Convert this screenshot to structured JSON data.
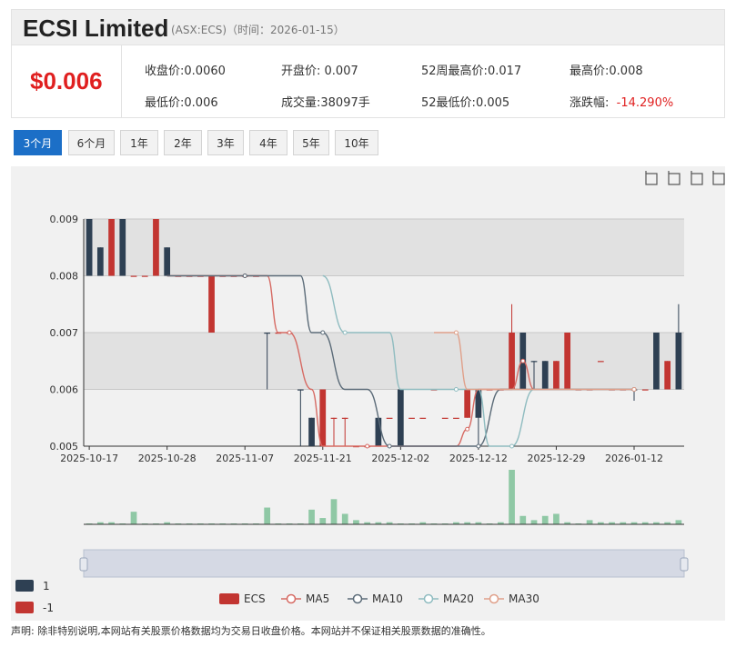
{
  "header": {
    "company": "ECSI Limited",
    "ticker_info": "(ASX:ECS)（时间：2026-01-15）"
  },
  "quote": {
    "price": "$0.006",
    "stats": [
      {
        "label": "收盘价:",
        "value": "0.0060"
      },
      {
        "label": "开盘价:",
        "value": " 0.007"
      },
      {
        "label": "52周最高价:",
        "value": "0.017"
      },
      {
        "label": "最高价:",
        "value": "0.008"
      },
      {
        "label": "最低价:",
        "value": "0.006"
      },
      {
        "label": "成交量:",
        "value": "38097手"
      },
      {
        "label": "52最低价:",
        "value": "0.005"
      },
      {
        "label": "涨跌幅:",
        "value": "-14.290%"
      }
    ]
  },
  "tabs": [
    "3个月",
    "6个月",
    "1年",
    "2年",
    "3年",
    "4年",
    "5年",
    "10年"
  ],
  "active_tab": 0,
  "toolbar": [
    "zoom-icon",
    "zoom-reset-icon",
    "restore-icon",
    "save-icon"
  ],
  "colors": {
    "up": "#2e4053",
    "down": "#c23531",
    "ma5": "#d66a63",
    "ma10": "#5b6b78",
    "ma20": "#8fbcc0",
    "ma30": "#e0a08a",
    "volume": "#8fc8a5",
    "accent": "#1c6fc7",
    "negative": "#e02020"
  },
  "chart_data": {
    "type": "candlestick",
    "ylim": [
      0.005,
      0.009
    ],
    "y_ticks": [
      "0.009",
      "0.008",
      "0.007",
      "0.006",
      "0.005"
    ],
    "x_ticks": [
      {
        "label": "2025-10-17",
        "i": 0
      },
      {
        "label": "2025-10-28",
        "i": 7
      },
      {
        "label": "2025-11-07",
        "i": 14
      },
      {
        "label": "2025-11-21",
        "i": 21
      },
      {
        "label": "2025-12-02",
        "i": 28
      },
      {
        "label": "2025-12-12",
        "i": 35
      },
      {
        "label": "2025-12-29",
        "i": 42
      },
      {
        "label": "2026-01-12",
        "i": 49
      }
    ],
    "candles": [
      [
        0.008,
        0.009,
        0.008,
        0.009,
        1,
        0
      ],
      [
        0.008,
        0.0085,
        0.008,
        0.0085,
        1,
        1
      ],
      [
        0.009,
        0.009,
        0.008,
        0.008,
        -1,
        1
      ],
      [
        0.008,
        0.009,
        0.008,
        0.009,
        1,
        0
      ],
      [
        0.008,
        0.008,
        0.008,
        0.008,
        -1,
        6
      ],
      [
        0.008,
        0.008,
        0.008,
        0.008,
        -1,
        0
      ],
      [
        0.009,
        0.009,
        0.008,
        0.008,
        -1,
        0
      ],
      [
        0.008,
        0.0085,
        0.008,
        0.0085,
        1,
        1
      ],
      [
        0.008,
        0.008,
        0.008,
        0.008,
        -1,
        0
      ],
      [
        0.008,
        0.008,
        0.008,
        0.008,
        -1,
        0
      ],
      [
        0.008,
        0.008,
        0.008,
        0.008,
        -1,
        0
      ],
      [
        0.008,
        0.008,
        0.007,
        0.007,
        -1,
        0
      ],
      [
        0.008,
        0.008,
        0.008,
        0.008,
        -1,
        0
      ],
      [
        0.008,
        0.008,
        0.008,
        0.008,
        -1,
        0
      ],
      [
        0.008,
        0.008,
        0.008,
        0.008,
        -1,
        0
      ],
      [
        0.008,
        0.008,
        0.008,
        0.008,
        -1,
        0
      ],
      [
        0.007,
        0.007,
        0.006,
        0.007,
        1,
        8
      ],
      [
        0.007,
        0.007,
        0.007,
        0.007,
        -1,
        0
      ],
      [
        0.007,
        0.007,
        0.007,
        0.007,
        -1,
        0
      ],
      [
        0.006,
        0.006,
        0.005,
        0.006,
        1,
        0
      ],
      [
        0.005,
        0.0055,
        0.005,
        0.0055,
        1,
        7
      ],
      [
        0.006,
        0.006,
        0.005,
        0.005,
        -1,
        3
      ],
      [
        0.0055,
        0.0055,
        0.005,
        0.0055,
        -1,
        12
      ],
      [
        0.0055,
        0.0055,
        0.005,
        0.0055,
        -1,
        5
      ],
      [
        0.005,
        0.005,
        0.005,
        0.005,
        -1,
        2
      ],
      [
        0.005,
        0.005,
        0.005,
        0.005,
        -1,
        1
      ],
      [
        0.005,
        0.0055,
        0.005,
        0.0055,
        1,
        1
      ],
      [
        0.0055,
        0.0055,
        0.0055,
        0.0055,
        -1,
        1
      ],
      [
        0.005,
        0.006,
        0.005,
        0.006,
        1,
        0
      ],
      [
        0.0055,
        0.0055,
        0.0055,
        0.0055,
        -1,
        0
      ],
      [
        0.0055,
        0.0055,
        0.0055,
        0.0055,
        -1,
        1
      ],
      [
        0.006,
        0.006,
        0.006,
        0.006,
        -1,
        0
      ],
      [
        0.0055,
        0.0055,
        0.0055,
        0.0055,
        -1,
        0
      ],
      [
        0.0055,
        0.0055,
        0.0055,
        0.0055,
        -1,
        1
      ],
      [
        0.006,
        0.006,
        0.0055,
        0.0055,
        -1,
        1
      ],
      [
        0.0055,
        0.006,
        0.005,
        0.006,
        1,
        1
      ],
      [
        0.006,
        0.006,
        0.006,
        0.006,
        -1,
        0
      ],
      [
        0.006,
        0.006,
        0.006,
        0.006,
        -1,
        1
      ],
      [
        0.007,
        0.0075,
        0.006,
        0.006,
        -1,
        26
      ],
      [
        0.006,
        0.007,
        0.006,
        0.007,
        1,
        4
      ],
      [
        0.0065,
        0.0065,
        0.006,
        0.0065,
        1,
        2
      ],
      [
        0.006,
        0.0065,
        0.006,
        0.0065,
        1,
        4
      ],
      [
        0.0065,
        0.0065,
        0.006,
        0.006,
        -1,
        5
      ],
      [
        0.007,
        0.007,
        0.006,
        0.006,
        -1,
        1
      ],
      [
        0.006,
        0.006,
        0.006,
        0.006,
        -1,
        0
      ],
      [
        0.006,
        0.006,
        0.006,
        0.006,
        -1,
        2
      ],
      [
        0.0065,
        0.0065,
        0.0065,
        0.0065,
        -1,
        1
      ],
      [
        0.006,
        0.006,
        0.006,
        0.006,
        -1,
        1
      ],
      [
        0.006,
        0.006,
        0.006,
        0.006,
        -1,
        1
      ],
      [
        0.006,
        0.006,
        0.0058,
        0.006,
        1,
        1
      ],
      [
        0.006,
        0.006,
        0.006,
        0.006,
        -1,
        1
      ],
      [
        0.006,
        0.007,
        0.006,
        0.007,
        1,
        1
      ],
      [
        0.0065,
        0.0065,
        0.006,
        0.006,
        -1,
        1
      ],
      [
        0.006,
        0.0075,
        0.006,
        0.007,
        1,
        2
      ]
    ],
    "ma_series": [
      {
        "name": "MA5",
        "points": [
          [
            7,
            0.008
          ],
          [
            14,
            0.008
          ],
          [
            16,
            0.008
          ],
          [
            17,
            0.007
          ],
          [
            18,
            0.007
          ],
          [
            20,
            0.006
          ],
          [
            21,
            0.005
          ],
          [
            25,
            0.005
          ],
          [
            28,
            0.005
          ],
          [
            33,
            0.005
          ],
          [
            34,
            0.0053
          ],
          [
            35,
            0.006
          ],
          [
            38,
            0.006
          ],
          [
            39,
            0.0065
          ],
          [
            40,
            0.006
          ],
          [
            43,
            0.006
          ],
          [
            49,
            0.006
          ]
        ]
      },
      {
        "name": "MA10",
        "points": [
          [
            7,
            0.008
          ],
          [
            14,
            0.008
          ],
          [
            19,
            0.008
          ],
          [
            20,
            0.007
          ],
          [
            21,
            0.007
          ],
          [
            23,
            0.006
          ],
          [
            25,
            0.006
          ],
          [
            27,
            0.005
          ],
          [
            28,
            0.005
          ],
          [
            33,
            0.005
          ],
          [
            35,
            0.005
          ],
          [
            37,
            0.006
          ],
          [
            43,
            0.006
          ],
          [
            49,
            0.006
          ]
        ]
      },
      {
        "name": "MA20",
        "points": [
          [
            21,
            0.008
          ],
          [
            23,
            0.007
          ],
          [
            27,
            0.007
          ],
          [
            28,
            0.006
          ],
          [
            33,
            0.006
          ],
          [
            35,
            0.006
          ],
          [
            36,
            0.005
          ],
          [
            38,
            0.005
          ],
          [
            40,
            0.006
          ],
          [
            49,
            0.006
          ]
        ]
      },
      {
        "name": "MA30",
        "points": [
          [
            31,
            0.007
          ],
          [
            33,
            0.007
          ],
          [
            34,
            0.006
          ],
          [
            41,
            0.006
          ],
          [
            49,
            0.006
          ]
        ]
      }
    ],
    "legend": [
      "ECS",
      "MA5",
      "MA10",
      "MA20",
      "MA30"
    ],
    "visual_map": [
      "1",
      "-1"
    ],
    "grid": true
  },
  "disclaimer": "声明: 除非特别说明,本网站有关股票价格数据均为交易日收盘价格。本网站并不保证相关股票数据的准确性。"
}
